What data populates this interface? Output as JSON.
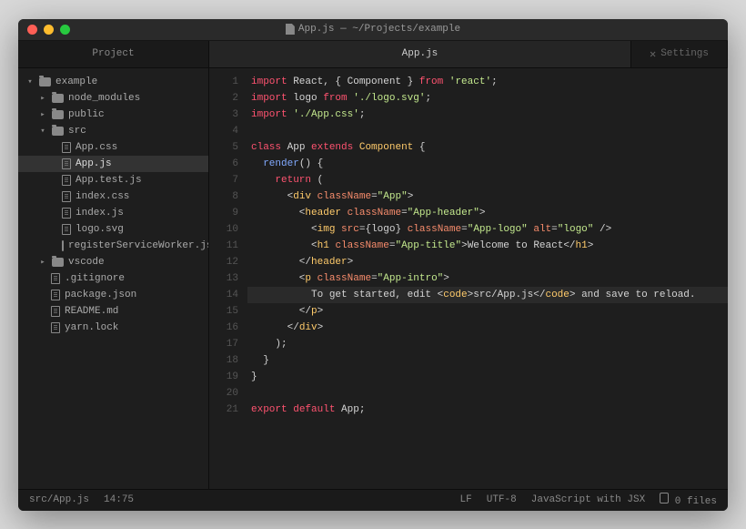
{
  "titlebar": {
    "text": "App.js — ~/Projects/example"
  },
  "tabs": {
    "project": "Project",
    "file": "App.js",
    "settings": "Settings"
  },
  "tree": {
    "root": "example",
    "node_modules": "node_modules",
    "public": "public",
    "src": "src",
    "files": {
      "app_css": "App.css",
      "app_js": "App.js",
      "app_test": "App.test.js",
      "index_css": "index.css",
      "index_js": "index.js",
      "logo_svg": "logo.svg",
      "rsw": "registerServiceWorker.js"
    },
    "vscode": "vscode",
    "gitignore": ".gitignore",
    "package": "package.json",
    "readme": "README.md",
    "yarn": "yarn.lock"
  },
  "code": {
    "l1": {
      "a": "import",
      "b": " React, { Component } ",
      "c": "from",
      "d": " ",
      "e": "'react'",
      "f": ";"
    },
    "l2": {
      "a": "import",
      "b": " logo ",
      "c": "from",
      "d": " ",
      "e": "'./logo.svg'",
      "f": ";"
    },
    "l3": {
      "a": "import",
      "b": " ",
      "e": "'./App.css'",
      "f": ";"
    },
    "l5": {
      "a": "class",
      "b": " App ",
      "c": "extends",
      "d": " ",
      "e": "Component",
      "f": " {"
    },
    "l6": {
      "a": "  ",
      "b": "render",
      "c": "() {"
    },
    "l7": {
      "a": "    ",
      "b": "return",
      "c": " ("
    },
    "l8": {
      "a": "      <",
      "b": "div",
      "c": " ",
      "d": "className",
      "e": "=",
      "f": "\"App\"",
      "g": ">"
    },
    "l9": {
      "a": "        <",
      "b": "header",
      "c": " ",
      "d": "className",
      "e": "=",
      "f": "\"App-header\"",
      "g": ">"
    },
    "l10": {
      "a": "          <",
      "b": "img",
      "c": " ",
      "d": "src",
      "e": "=",
      "f": "{logo}",
      "g": " ",
      "h": "className",
      "i": "=",
      "j": "\"App-logo\"",
      "k": " ",
      "l": "alt",
      "m": "=",
      "n": "\"logo\"",
      "o": " />"
    },
    "l11": {
      "a": "          <",
      "b": "h1",
      "c": " ",
      "d": "className",
      "e": "=",
      "f": "\"App-title\"",
      "g": ">",
      "h": "Welcome to React",
      "i": "</",
      "j": "h1",
      "k": ">"
    },
    "l12": {
      "a": "        </",
      "b": "header",
      "c": ">"
    },
    "l13": {
      "a": "        <",
      "b": "p",
      "c": " ",
      "d": "className",
      "e": "=",
      "f": "\"App-intro\"",
      "g": ">"
    },
    "l14": {
      "a": "          To get started, edit <",
      "b": "code",
      "c": ">",
      "d": "src/App.js",
      "e": "</",
      "f": "code",
      "g": "> and save to reload."
    },
    "l15": {
      "a": "        </",
      "b": "p",
      "c": ">"
    },
    "l16": {
      "a": "      </",
      "b": "div",
      "c": ">"
    },
    "l17": "    );",
    "l18": "  }",
    "l19": "}",
    "l21": {
      "a": "export",
      "b": " ",
      "c": "default",
      "d": " App;"
    }
  },
  "statusbar": {
    "path": "src/App.js",
    "cursor": "14:75",
    "line_ending": "LF",
    "encoding": "UTF-8",
    "language": "JavaScript with JSX",
    "files": "0 files"
  },
  "line_numbers": [
    "1",
    "2",
    "3",
    "4",
    "5",
    "6",
    "7",
    "8",
    "9",
    "10",
    "11",
    "12",
    "13",
    "14",
    "15",
    "16",
    "17",
    "18",
    "19",
    "20",
    "21"
  ]
}
